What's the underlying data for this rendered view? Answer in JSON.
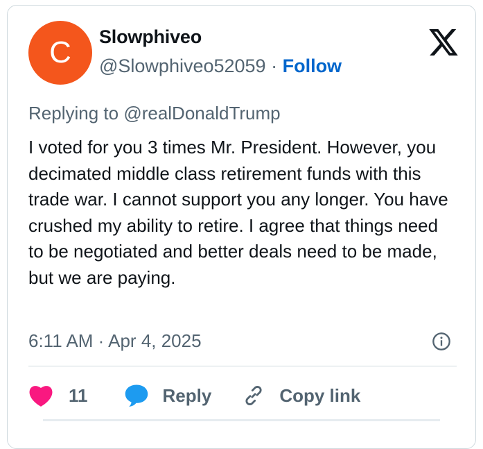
{
  "user": {
    "avatar_letter": "C",
    "display_name": "Slowphiveo",
    "handle": "@Slowphiveo52059",
    "separator": " · ",
    "follow_label": "Follow"
  },
  "platform_icon": "x-logo-icon",
  "tweet": {
    "replying_to_prefix": "Replying to ",
    "replying_to_handle": "@realDonaldTrump",
    "text": "I voted for you 3 times Mr. President. However, you decimated middle class retirement funds with this trade war. I cannot support you any longer. You have crushed my ability to retire. I agree that things need to be negotiated and better deals need to be made, but we are paying.",
    "timestamp": "6:11 AM · Apr 4, 2025"
  },
  "actions": {
    "like_count": "11",
    "reply_label": "Reply",
    "copy_link_label": "Copy link"
  },
  "icons": {
    "heart": "heart-icon",
    "reply": "speech-bubble-icon",
    "link": "link-icon",
    "info": "info-icon"
  },
  "colors": {
    "avatar_bg": "#f4561c",
    "link_blue": "#0066cc",
    "heart_pink": "#f91880",
    "reply_blue": "#1d9bf0",
    "secondary_text": "#536471",
    "primary_text": "#0f1419",
    "border": "#cfd9de"
  }
}
